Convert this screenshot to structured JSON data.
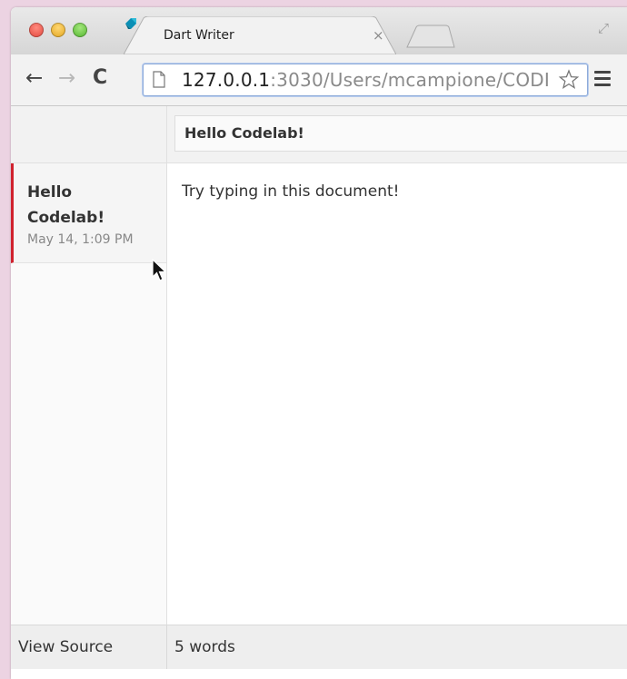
{
  "browser": {
    "tab_title": "Dart Writer",
    "tab_close": "×",
    "url_host": "127.0.0.1",
    "url_rest": ":3030/Users/mcampione/CODI"
  },
  "sidebar": {
    "notes": [
      {
        "title": "Hello Codelab!",
        "date": "May 14, 1:09 PM",
        "selected": true
      }
    ]
  },
  "editor": {
    "title": "Hello Codelab!",
    "body": "Try typing in this document!"
  },
  "footer": {
    "view_source": "View Source",
    "word_count": "5 words"
  },
  "colors": {
    "accent": "#d0212d",
    "background": "#ecd3e2"
  }
}
